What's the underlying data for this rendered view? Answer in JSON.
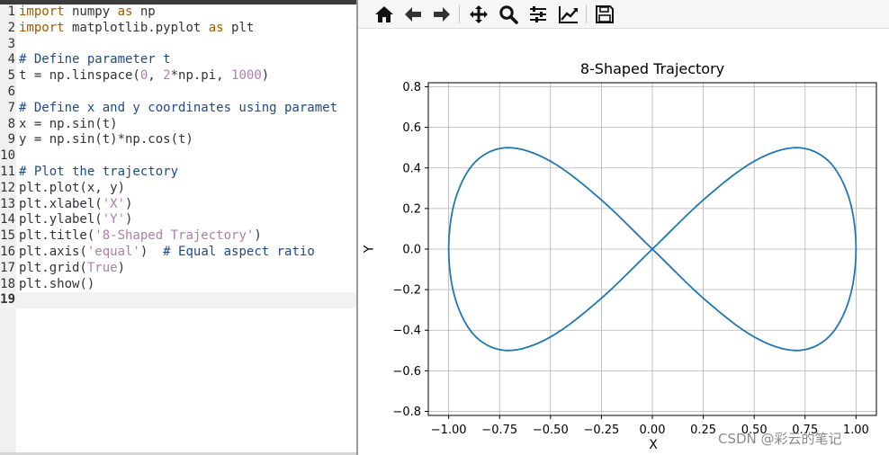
{
  "editor": {
    "lines": [
      {
        "num": "1",
        "tokens": [
          {
            "t": "import",
            "c": "kw"
          },
          {
            "t": " numpy ",
            "c": ""
          },
          {
            "t": "as",
            "c": "kw"
          },
          {
            "t": " np",
            "c": ""
          }
        ]
      },
      {
        "num": "2",
        "tokens": [
          {
            "t": "import",
            "c": "kw"
          },
          {
            "t": " matplotlib.pyplot ",
            "c": ""
          },
          {
            "t": "as",
            "c": "kw"
          },
          {
            "t": " plt",
            "c": ""
          }
        ]
      },
      {
        "num": "3",
        "tokens": []
      },
      {
        "num": "4",
        "tokens": [
          {
            "t": "# Define parameter t",
            "c": "cm"
          }
        ]
      },
      {
        "num": "5",
        "tokens": [
          {
            "t": "t = np.linspace(",
            "c": ""
          },
          {
            "t": "0",
            "c": "nm"
          },
          {
            "t": ", ",
            "c": ""
          },
          {
            "t": "2",
            "c": "nm"
          },
          {
            "t": "*np.pi, ",
            "c": ""
          },
          {
            "t": "1000",
            "c": "nm"
          },
          {
            "t": ")",
            "c": ""
          }
        ]
      },
      {
        "num": "6",
        "tokens": []
      },
      {
        "num": "7",
        "tokens": [
          {
            "t": "# Define x and y coordinates using paramet",
            "c": "cm"
          }
        ]
      },
      {
        "num": "8",
        "tokens": [
          {
            "t": "x = np.sin(t)",
            "c": ""
          }
        ]
      },
      {
        "num": "9",
        "tokens": [
          {
            "t": "y = np.sin(t)*np.cos(t)",
            "c": ""
          }
        ]
      },
      {
        "num": "10",
        "tokens": []
      },
      {
        "num": "11",
        "tokens": [
          {
            "t": "# Plot the trajectory",
            "c": "cm"
          }
        ]
      },
      {
        "num": "12",
        "tokens": [
          {
            "t": "plt.plot(x, y)",
            "c": ""
          }
        ]
      },
      {
        "num": "13",
        "tokens": [
          {
            "t": "plt.xlabel(",
            "c": ""
          },
          {
            "t": "'X'",
            "c": "st"
          },
          {
            "t": ")",
            "c": ""
          }
        ]
      },
      {
        "num": "14",
        "tokens": [
          {
            "t": "plt.ylabel(",
            "c": ""
          },
          {
            "t": "'Y'",
            "c": "st"
          },
          {
            "t": ")",
            "c": ""
          }
        ]
      },
      {
        "num": "15",
        "tokens": [
          {
            "t": "plt.title(",
            "c": ""
          },
          {
            "t": "'8-Shaped Trajectory'",
            "c": "st"
          },
          {
            "t": ")",
            "c": ""
          }
        ]
      },
      {
        "num": "16",
        "tokens": [
          {
            "t": "plt.axis(",
            "c": ""
          },
          {
            "t": "'equal'",
            "c": "st"
          },
          {
            "t": ")  ",
            "c": ""
          },
          {
            "t": "# Equal aspect ratio",
            "c": "cm"
          }
        ]
      },
      {
        "num": "17",
        "tokens": [
          {
            "t": "plt.grid(",
            "c": ""
          },
          {
            "t": "True",
            "c": "nm"
          },
          {
            "t": ")",
            "c": ""
          }
        ]
      },
      {
        "num": "18",
        "tokens": [
          {
            "t": "plt.show()",
            "c": ""
          }
        ]
      },
      {
        "num": "19",
        "tokens": [],
        "current": true
      }
    ]
  },
  "toolbar": {
    "buttons": [
      {
        "name": "home-button",
        "icon": "home-icon"
      },
      {
        "name": "back-button",
        "icon": "arrow-left-icon"
      },
      {
        "name": "forward-button",
        "icon": "arrow-right-icon"
      },
      {
        "name": "pan-button",
        "icon": "move-icon"
      },
      {
        "name": "zoom-button",
        "icon": "magnifier-icon"
      },
      {
        "name": "subplots-button",
        "icon": "sliders-icon"
      },
      {
        "name": "edit-axes-button",
        "icon": "chart-line-icon"
      },
      {
        "name": "save-button",
        "icon": "floppy-disk-icon"
      }
    ]
  },
  "chart_data": {
    "type": "line",
    "title": "8-Shaped Trajectory",
    "xlabel": "X",
    "ylabel": "Y",
    "xlim": [
      -1.1,
      1.1
    ],
    "ylim": [
      -0.82,
      0.82
    ],
    "xticks": [
      -1.0,
      -0.75,
      -0.5,
      -0.25,
      0.0,
      0.25,
      0.5,
      0.75,
      1.0
    ],
    "xtick_labels": [
      "−1.00",
      "−0.75",
      "−0.50",
      "−0.25",
      "0.00",
      "0.25",
      "0.50",
      "0.75",
      "1.00"
    ],
    "yticks": [
      0.8,
      0.6,
      0.4,
      0.2,
      0.0,
      -0.2,
      -0.4,
      -0.6,
      -0.8
    ],
    "ytick_labels": [
      "0.8",
      "0.6",
      "0.4",
      "0.2",
      "0.0",
      "−0.2",
      "−0.4",
      "−0.6",
      "−0.8"
    ],
    "grid": true,
    "series": [
      {
        "color": "#1f77b4",
        "x": [
          0.0,
          0.259,
          0.5,
          0.707,
          0.866,
          0.966,
          1.0,
          0.966,
          0.866,
          0.707,
          0.5,
          0.259,
          0.0,
          -0.259,
          -0.5,
          -0.707,
          -0.866,
          -0.966,
          -1.0,
          -0.966,
          -0.866,
          -0.707,
          -0.5,
          -0.259,
          0.0
        ],
        "y": [
          0.0,
          0.25,
          0.433,
          0.5,
          0.433,
          0.25,
          0.0,
          -0.25,
          -0.433,
          -0.5,
          -0.433,
          -0.25,
          0.0,
          0.25,
          0.433,
          0.5,
          0.433,
          0.25,
          0.0,
          -0.25,
          -0.433,
          -0.5,
          -0.433,
          -0.25,
          0.0
        ]
      }
    ]
  },
  "watermark": "CSDN @彩云的笔记"
}
